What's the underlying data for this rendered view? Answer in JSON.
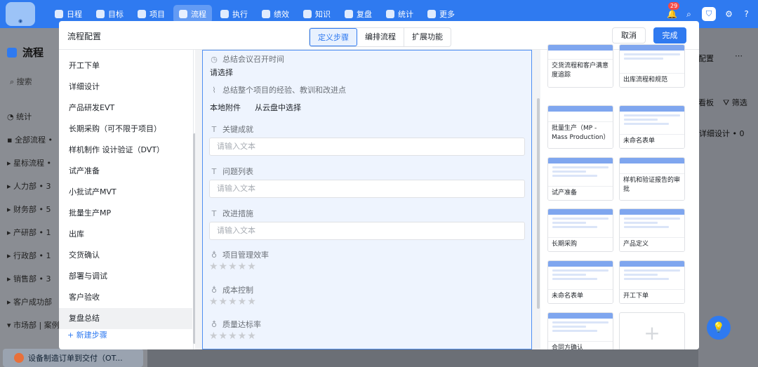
{
  "topnav": {
    "items": [
      {
        "label": "日程",
        "icon": "calendar-icon",
        "active": false
      },
      {
        "label": "目标",
        "icon": "target-icon",
        "active": false
      },
      {
        "label": "项目",
        "icon": "cube-icon",
        "active": false
      },
      {
        "label": "流程",
        "icon": "flow-icon",
        "active": true
      },
      {
        "label": "执行",
        "icon": "list-icon",
        "active": false
      },
      {
        "label": "绩效",
        "icon": "chart-icon",
        "active": false
      },
      {
        "label": "知识",
        "icon": "book-icon",
        "active": false
      },
      {
        "label": "复盘",
        "icon": "review-icon",
        "active": false
      },
      {
        "label": "统计",
        "icon": "stats-icon",
        "active": false
      },
      {
        "label": "更多",
        "icon": "grid-icon",
        "active": false
      }
    ],
    "notification_count": "29"
  },
  "left_panel": {
    "title": "流程",
    "search_placeholder": "搜索",
    "stats_label": "统计",
    "items": [
      "全部流程 •",
      "星标流程 •",
      "人力部 • 3",
      "财务部 • 5",
      "产研部 • 1",
      "行政部 • 1",
      "销售部 • 3",
      "客户成功部",
      "市场部 | 案例"
    ],
    "bottom_item": "设备制造订单到交付（OT..."
  },
  "right_bg": {
    "config_label": "配置",
    "board_label": "看板",
    "filter_label": "筛选",
    "detail_label": "详细设计 • 0"
  },
  "modal": {
    "title": "流程配置",
    "tabs": [
      "定义步骤",
      "编排流程",
      "扩展功能"
    ],
    "active_tab": 0,
    "cancel_label": "取消",
    "done_label": "完成",
    "steps": [
      "开工下单",
      "详细设计",
      "产品研发EVT",
      "长期采购（可不限于项目）",
      "样机制作 设计验证（DVT）",
      "试产准备",
      "小批试产MVT",
      "批量生产MP",
      "出库",
      "交货确认",
      "部署与调试",
      "客户验收",
      "复盘总结"
    ],
    "active_step": 12,
    "add_step_label": "+ 新建步骤",
    "form": {
      "meeting_time_label": "总结会议召开时间",
      "meeting_time_value": "请选择",
      "attachment_label": "总结整个项目的经验、教训和改进点",
      "local_attach": "本地附件",
      "cloud_attach": "从云盘中选择",
      "achievements_label": "关键成就",
      "achievements_placeholder": "请输入文本",
      "issues_label": "问题列表",
      "issues_placeholder": "请输入文本",
      "improvements_label": "改进措施",
      "improvements_placeholder": "请输入文本",
      "rating1_label": "项目管理效率",
      "rating2_label": "成本控制",
      "rating3_label": "质量达标率",
      "stars": "★★★★★"
    },
    "templates": [
      "交货流程和客户满意度追踪",
      "出库流程和规范",
      "批量生产（MP - Mass Production）",
      "未命名表单",
      "试产准备",
      "样机和验证报告的审批",
      "长期采购",
      "产品定义",
      "未命名表单",
      "开工下单",
      "合同方确认"
    ]
  }
}
